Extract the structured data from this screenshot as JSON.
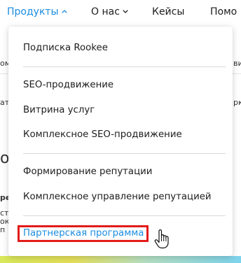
{
  "nav": {
    "products": "Продукты",
    "about": "О нас",
    "cases": "Кейсы",
    "help": "Помо"
  },
  "background": {
    "frag1": "ом",
    "frag2": "виз",
    "frag3": "ат",
    "frag4": "рк",
    "frag5": "о",
    "frag6": "ре",
    "frag7": "ст",
    "frag8": "ок",
    "frag9": "п"
  },
  "dropdown": {
    "items": [
      "Подписка Rookee",
      "SEO-продвижение",
      "Витрина услуг",
      "Комплексное SEO-продвижение",
      "Формирование репутации",
      "Комплексное управление репутацией",
      "Партнерская программа"
    ]
  },
  "colors": {
    "accent": "#1a8ce0",
    "highlight": "#e21b1b"
  }
}
